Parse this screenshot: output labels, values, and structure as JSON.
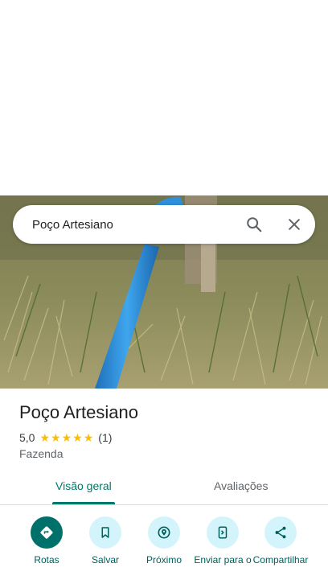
{
  "search": {
    "query": "Poço Artesiano"
  },
  "place": {
    "name": "Poço Artesiano",
    "rating": "5,0",
    "stars": 5,
    "review_count": "(1)",
    "category": "Fazenda"
  },
  "tabs": [
    {
      "label": "Visão geral",
      "active": true
    },
    {
      "label": "Avaliações",
      "active": false
    }
  ],
  "actions": [
    {
      "label": "Rotas",
      "icon": "directions-icon"
    },
    {
      "label": "Salvar",
      "icon": "bookmark-icon"
    },
    {
      "label": "Próximo",
      "icon": "nearby-icon"
    },
    {
      "label": "Enviar para o",
      "icon": "send-to-phone-icon"
    },
    {
      "label": "Compartilhar",
      "icon": "share-icon"
    }
  ],
  "colors": {
    "accent": "#00796b",
    "primary_button": "#00706a",
    "secondary_button": "#d3f4fb",
    "star": "#fbbc04",
    "pipe": "#2a8fd8"
  }
}
